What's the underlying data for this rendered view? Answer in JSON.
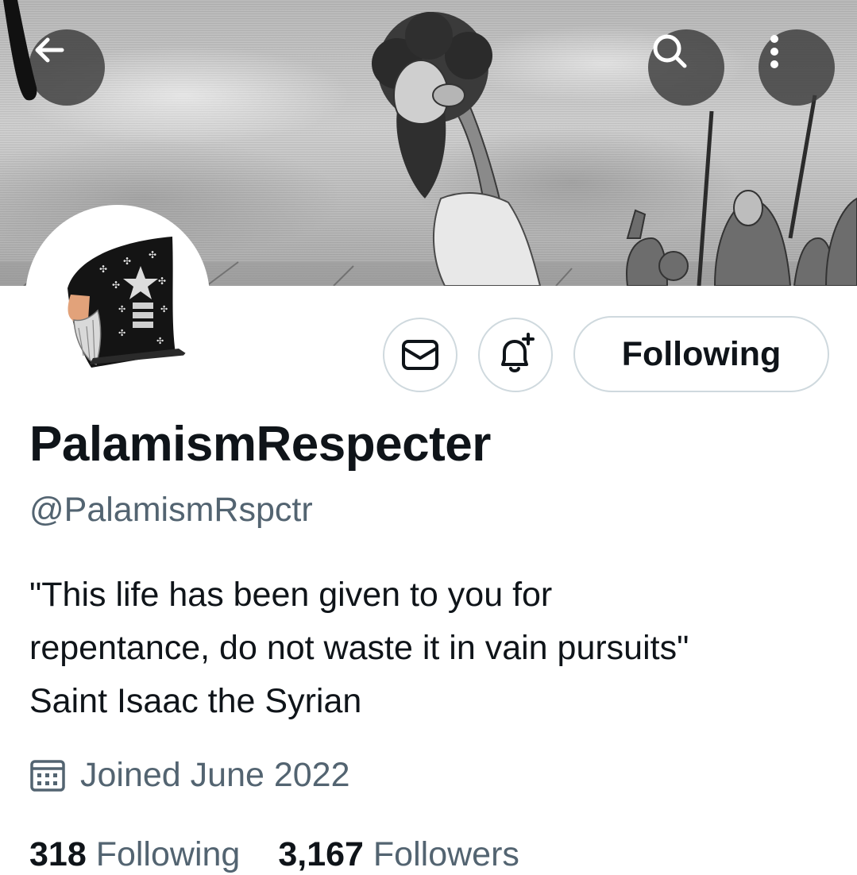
{
  "header": {
    "back_icon": "arrow-left-icon",
    "search_icon": "search-icon",
    "more_icon": "more-vertical-icon"
  },
  "profile": {
    "display_name": "PalamismRespecter",
    "handle": "@PalamismRspctr",
    "bio_lines": [
      "\"This life has been given to you for",
      "repentance, do not waste it in vain pursuits\"",
      "Saint Isaac the Syrian"
    ],
    "joined_icon": "calendar-icon",
    "joined": "Joined June 2022"
  },
  "actions": {
    "message_icon": "mail-icon",
    "notify_icon": "bell-plus-icon",
    "follow_label": "Following"
  },
  "stats": {
    "following_count": "318",
    "following_label": "Following",
    "followers_count": "3,167",
    "followers_label": "Followers"
  },
  "colors": {
    "primary_text": "#0f1419",
    "secondary_text": "#536471",
    "button_border": "#cfd9de",
    "overlay_button": "#3c3c3c"
  }
}
